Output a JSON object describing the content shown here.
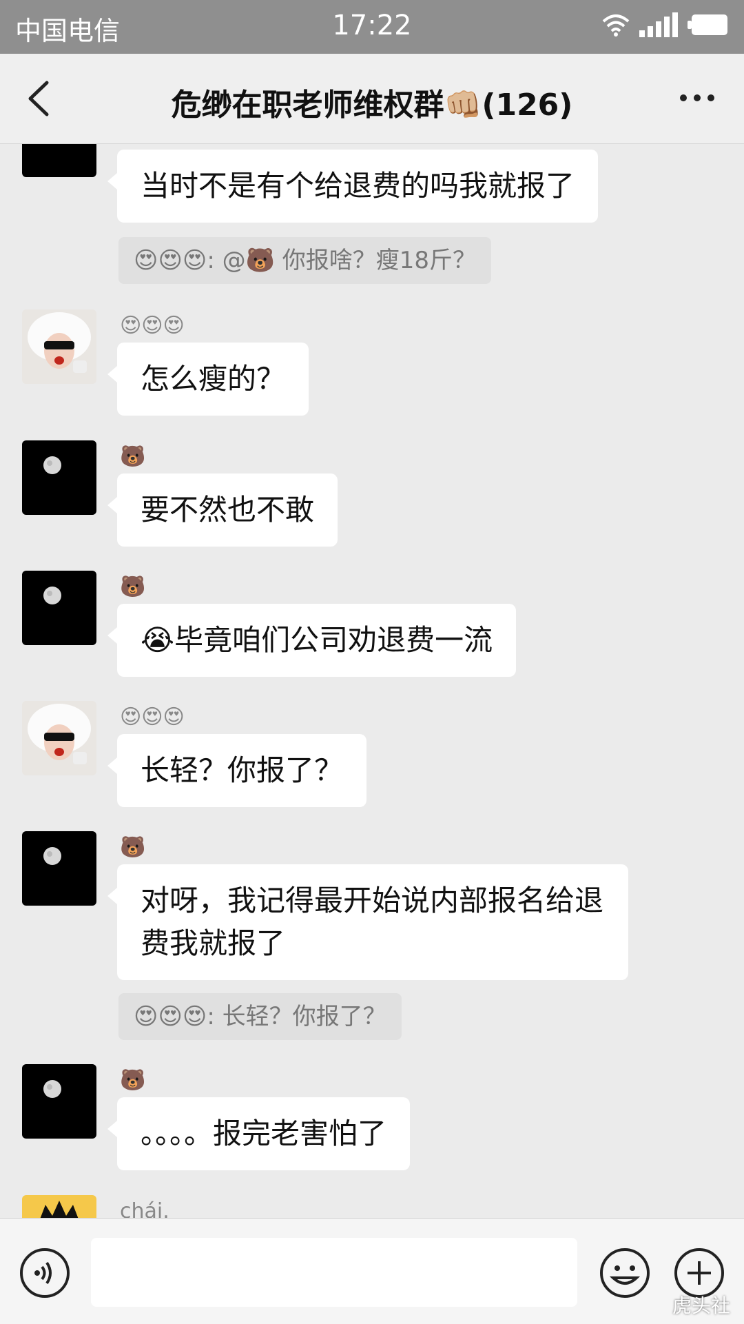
{
  "status_bar": {
    "carrier": "中国电信",
    "time": "17:22"
  },
  "nav": {
    "title": "危缈在职老师维权群👊🏼(126)"
  },
  "messages": [
    {
      "sender": "🐻",
      "text": "当时不是有个给退费的吗我就报了",
      "avatar": "moon-avatar"
    },
    {
      "quote": {
        "sender": "😍😍😍",
        "text": "@🐻 你报啥？瘦18斤？"
      }
    },
    {
      "sender": "😍😍😍",
      "text": "怎么瘦的？",
      "avatar": "girl-avatar"
    },
    {
      "sender": "🐻",
      "text": "要不然也不敢",
      "avatar": "moon-avatar"
    },
    {
      "sender": "🐻",
      "text": "😭毕竟咱们公司劝退费一流",
      "avatar": "moon-avatar"
    },
    {
      "sender": "😍😍😍",
      "text": "长轻？你报了？",
      "avatar": "girl-avatar"
    },
    {
      "sender": "🐻",
      "text": "对呀，我记得最开始说内部报名给退费我就报了",
      "avatar": "moon-avatar"
    },
    {
      "quote": {
        "sender": "😍😍😍",
        "text": "长轻？你报了？"
      }
    },
    {
      "sender": "🐻",
      "text": "。。。。报完老害怕了",
      "avatar": "moon-avatar"
    },
    {
      "sender": "chái.",
      "avatar": "cartoon-avatar"
    }
  ],
  "input": {
    "placeholder": ""
  },
  "watermark": "虎头社",
  "colors": {
    "status_bar": "#8f8f8f",
    "nav_bg": "#efefef",
    "chat_bg": "#ebebeb",
    "bubble": "#ffffff"
  }
}
